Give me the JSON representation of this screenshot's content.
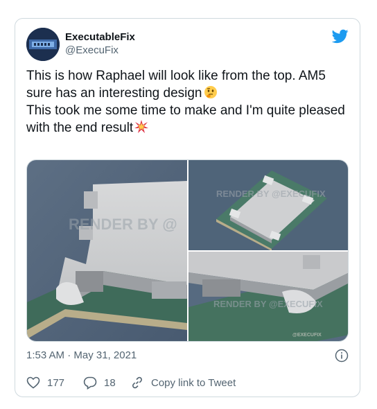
{
  "tweet": {
    "author": {
      "display_name": "ExecutableFix",
      "handle": "@ExecuFix"
    },
    "text_line1": "This is how Raphael will look like from the top. AM5 sure has an interesting design",
    "text_line2": "This took me some time to make and I'm quite pleased with the end result",
    "emoji1": "thinking-face-emoji",
    "emoji2": "collision-emoji",
    "watermark_main": "RENDER BY @",
    "watermark_tr": "RENDER BY @EXECUFIX",
    "watermark_br": "RENDER BY @EXECUFIX",
    "corner_tag": "@EXECUFIX",
    "timestamp": "1:53 AM · May 31, 2021",
    "likes": "177",
    "replies": "18",
    "copy_link_label": "Copy link to Tweet"
  },
  "colors": {
    "twitter_blue": "#1d9bf0",
    "text_primary": "#0f1419",
    "text_secondary": "#536471",
    "border": "#cfd9de"
  }
}
